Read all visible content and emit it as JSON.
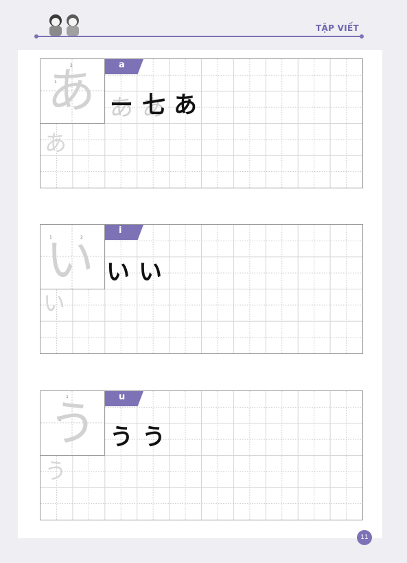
{
  "header": {
    "title": "TẬP VIẾT"
  },
  "blocks": [
    {
      "label": "a",
      "model": "あ",
      "strokes": [
        "ー",
        "七",
        "あ"
      ]
    },
    {
      "label": "i",
      "model": "い",
      "strokes": [
        "い",
        "い"
      ]
    },
    {
      "label": "u",
      "model": "う",
      "strokes": [
        "う",
        "う"
      ]
    }
  ],
  "page_number": "11",
  "colors": {
    "accent": "#7d72b6",
    "grid_border": "#9a9a9a",
    "grid_dots": "#c9c9c9"
  }
}
